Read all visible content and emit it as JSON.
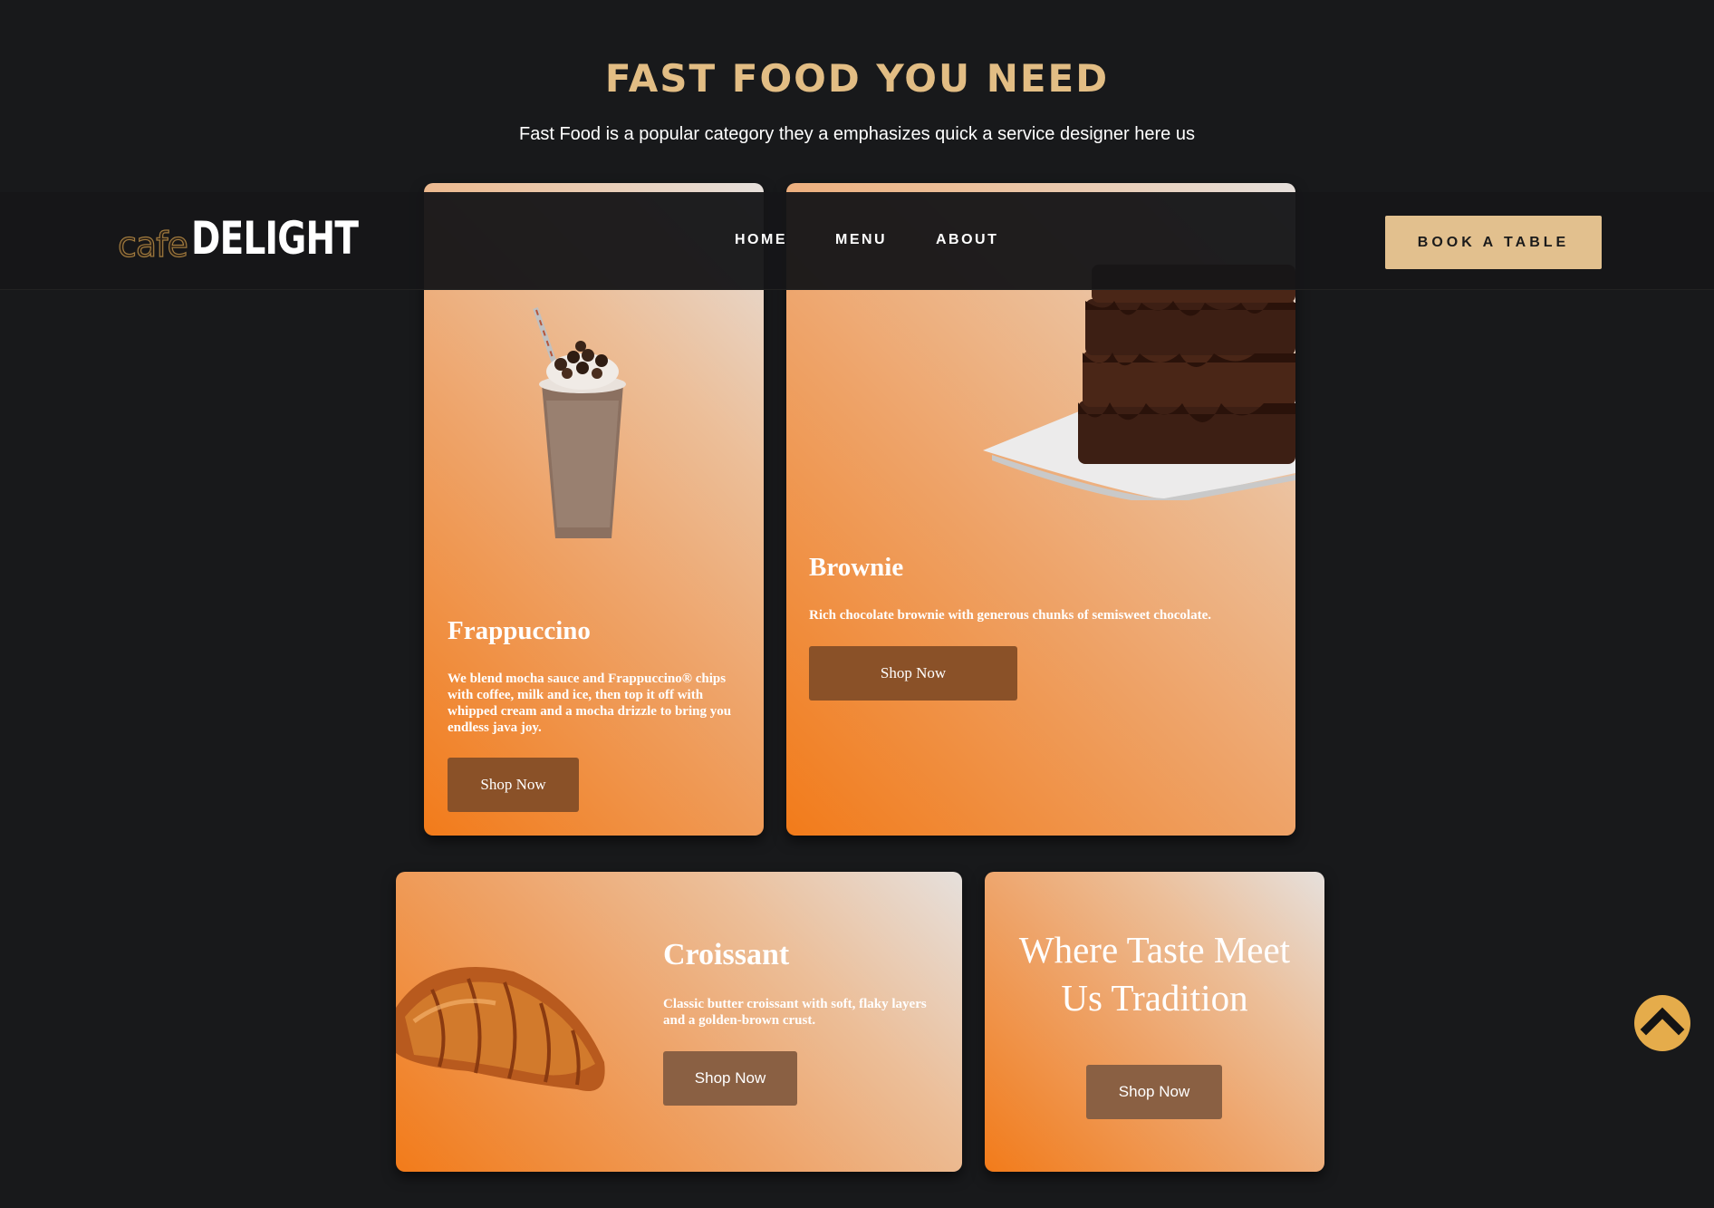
{
  "section": {
    "title": "FAST FOOD YOU NEED",
    "subtitle": "Fast Food is a popular category they a emphasizes quick a service designer here us"
  },
  "header": {
    "logo_script": "cafe",
    "logo_main": "DELIGHT",
    "nav": [
      "HOME",
      "MENU",
      "ABOUT"
    ],
    "cta_label": "BOOK A TABLE"
  },
  "cards": [
    {
      "title": "Frappuccino",
      "description": "We blend mocha sauce and Frappuccino® chips with coffee, milk and ice, then top it off with whipped cream and a mocha drizzle to bring you endless java joy.",
      "button": "Shop Now",
      "image_icon": "frappuccino-image"
    },
    {
      "title": "Brownie",
      "description": "Rich chocolate brownie with generous chunks of semisweet chocolate.",
      "button": "Shop Now",
      "image_icon": "brownie-image"
    },
    {
      "title": "Croissant",
      "description": "Classic butter croissant with soft, flaky layers and a golden-brown crust.",
      "button": "Shop Now",
      "image_icon": "croissant-image"
    },
    {
      "title": "Where Taste Meet Us Tradition",
      "button": "Shop Now"
    }
  ],
  "scroll_top_icon": "chevron-up-icon",
  "colors": {
    "background": "#18191b",
    "accent_gold": "#e2bd84",
    "button_brown": "#8a5128",
    "card_gradient_start": "#f27b1a",
    "card_gradient_end": "#e6e0dc",
    "scroll_button": "#e5ac4b"
  }
}
